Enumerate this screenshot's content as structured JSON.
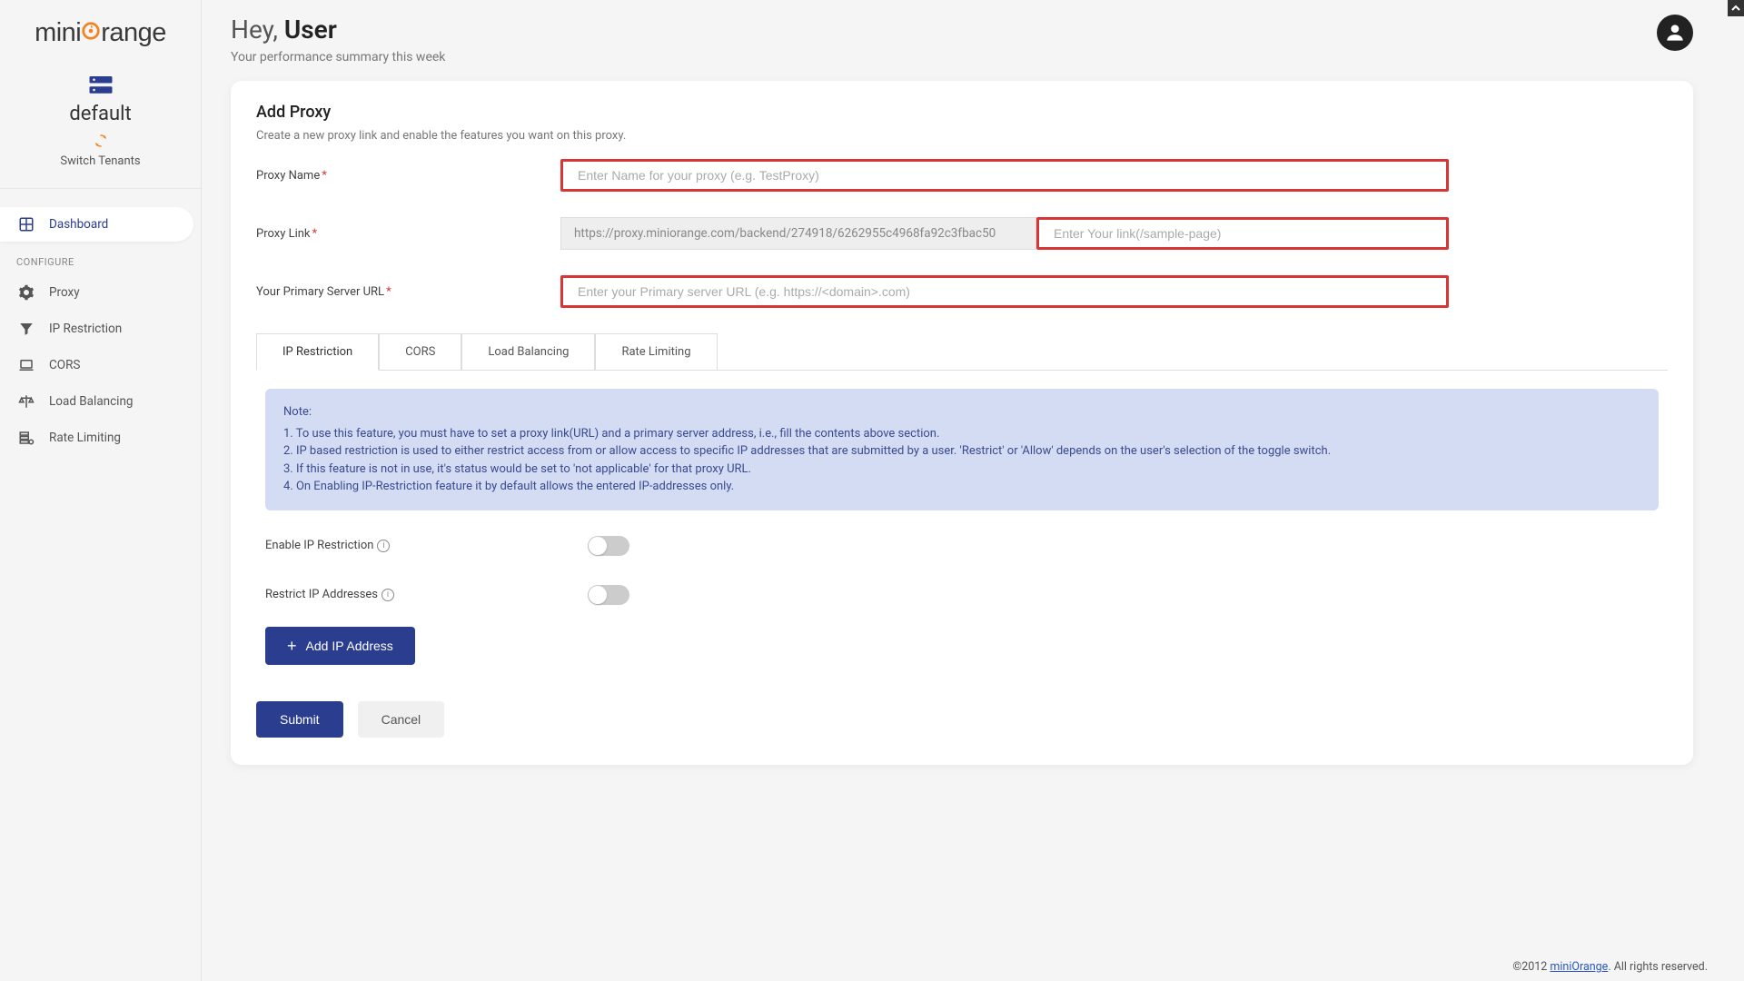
{
  "brand": {
    "name_part1": "mini",
    "name_part2": "range"
  },
  "tenant": {
    "name": "default",
    "switch_label": "Switch Tenants"
  },
  "nav": {
    "dashboard": "Dashboard",
    "configure_header": "CONFIGURE",
    "items": [
      {
        "label": "Proxy"
      },
      {
        "label": "IP Restriction"
      },
      {
        "label": "CORS"
      },
      {
        "label": "Load Balancing"
      },
      {
        "label": "Rate Limiting"
      }
    ]
  },
  "greeting": {
    "prefix": "Hey, ",
    "name": "User",
    "sub": "Your performance summary this week"
  },
  "card": {
    "title": "Add Proxy",
    "desc": "Create a new proxy link and enable the features you want on this proxy.",
    "fields": {
      "proxy_name": {
        "label": "Proxy Name",
        "placeholder": "Enter Name for your proxy (e.g. TestProxy)"
      },
      "proxy_link": {
        "label": "Proxy Link",
        "readonly_value": "https://proxy.miniorange.com/backend/274918/6262955c4968fa92c3fbac50",
        "placeholder": "Enter Your link(/sample-page)"
      },
      "primary_url": {
        "label": "Your Primary Server URL",
        "placeholder": "Enter your Primary server URL (e.g. https://<domain>.com)"
      }
    },
    "tabs": {
      "ip": "IP Restriction",
      "cors": "CORS",
      "lb": "Load Balancing",
      "rl": "Rate Limiting"
    },
    "note": {
      "title": "Note:",
      "l1": "1. To use this feature, you must have to set a proxy link(URL) and a primary server address, i.e., fill the contents above section.",
      "l2": "2. IP based restriction is used to either restrict access from or allow access to specific IP addresses that are submitted by a user. 'Restrict' or 'Allow' depends on the user's selection of the toggle switch.",
      "l3": "3. If this feature is not in use, it's status would be set to 'not applicable' for that proxy URL.",
      "l4": "4. On Enabling IP-Restriction feature it by default allows the entered IP-addresses only."
    },
    "toggles": {
      "enable_ip": "Enable IP Restriction",
      "restrict_ip": "Restrict IP Addresses"
    },
    "add_ip_btn": "Add IP Address",
    "submit": "Submit",
    "cancel": "Cancel"
  },
  "footer": {
    "year": "©2012 ",
    "link": "miniOrange",
    "rest": ". All rights reserved."
  }
}
